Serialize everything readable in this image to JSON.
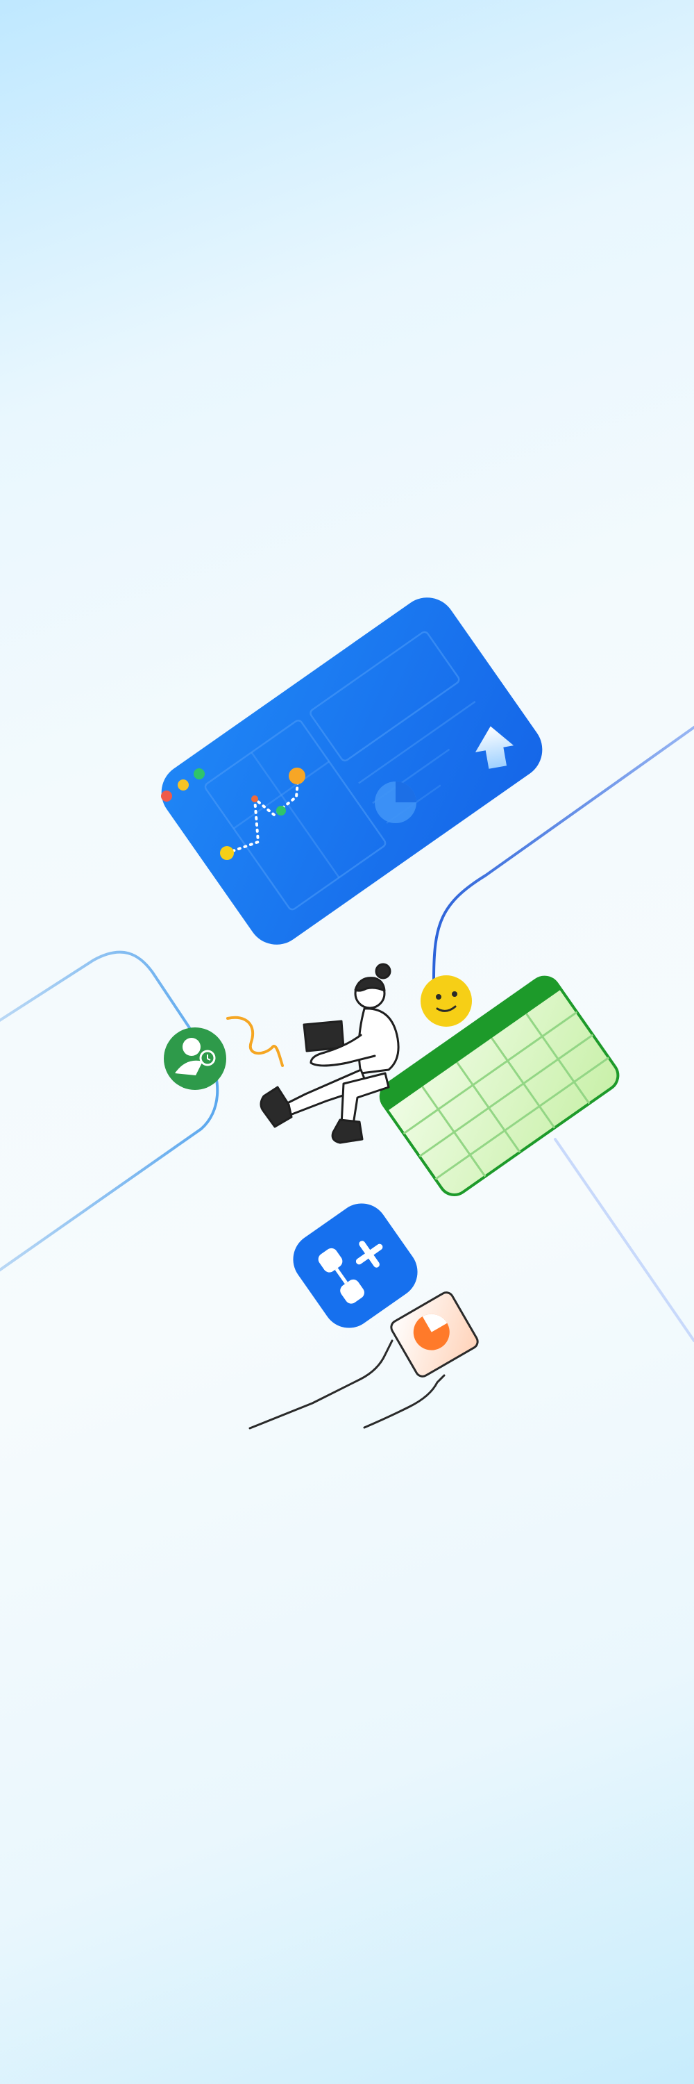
{
  "illustration": {
    "colors": {
      "background_top": "#bfe8ff",
      "background_mid": "#f5fbfd",
      "background_bottom": "#c7ecfc",
      "dashboard_card": "#1a73f0",
      "spreadsheet_header": "#1d9a2a",
      "spreadsheet_fill": "#d9f6c5",
      "app_tile": "#1670ee",
      "accent_orange": "#f59a23",
      "accent_yellow": "#f6cf16",
      "badge_green": "#2e9a4a"
    },
    "icons": [
      "dashboard-card-icon",
      "line-chart-icon",
      "pie-chart-icon",
      "upload-arrow-icon",
      "spreadsheet-card-icon",
      "smiley-face-icon",
      "user-badge-icon",
      "person-with-laptop-icon",
      "workflow-app-icon",
      "chart-card-icon"
    ]
  }
}
